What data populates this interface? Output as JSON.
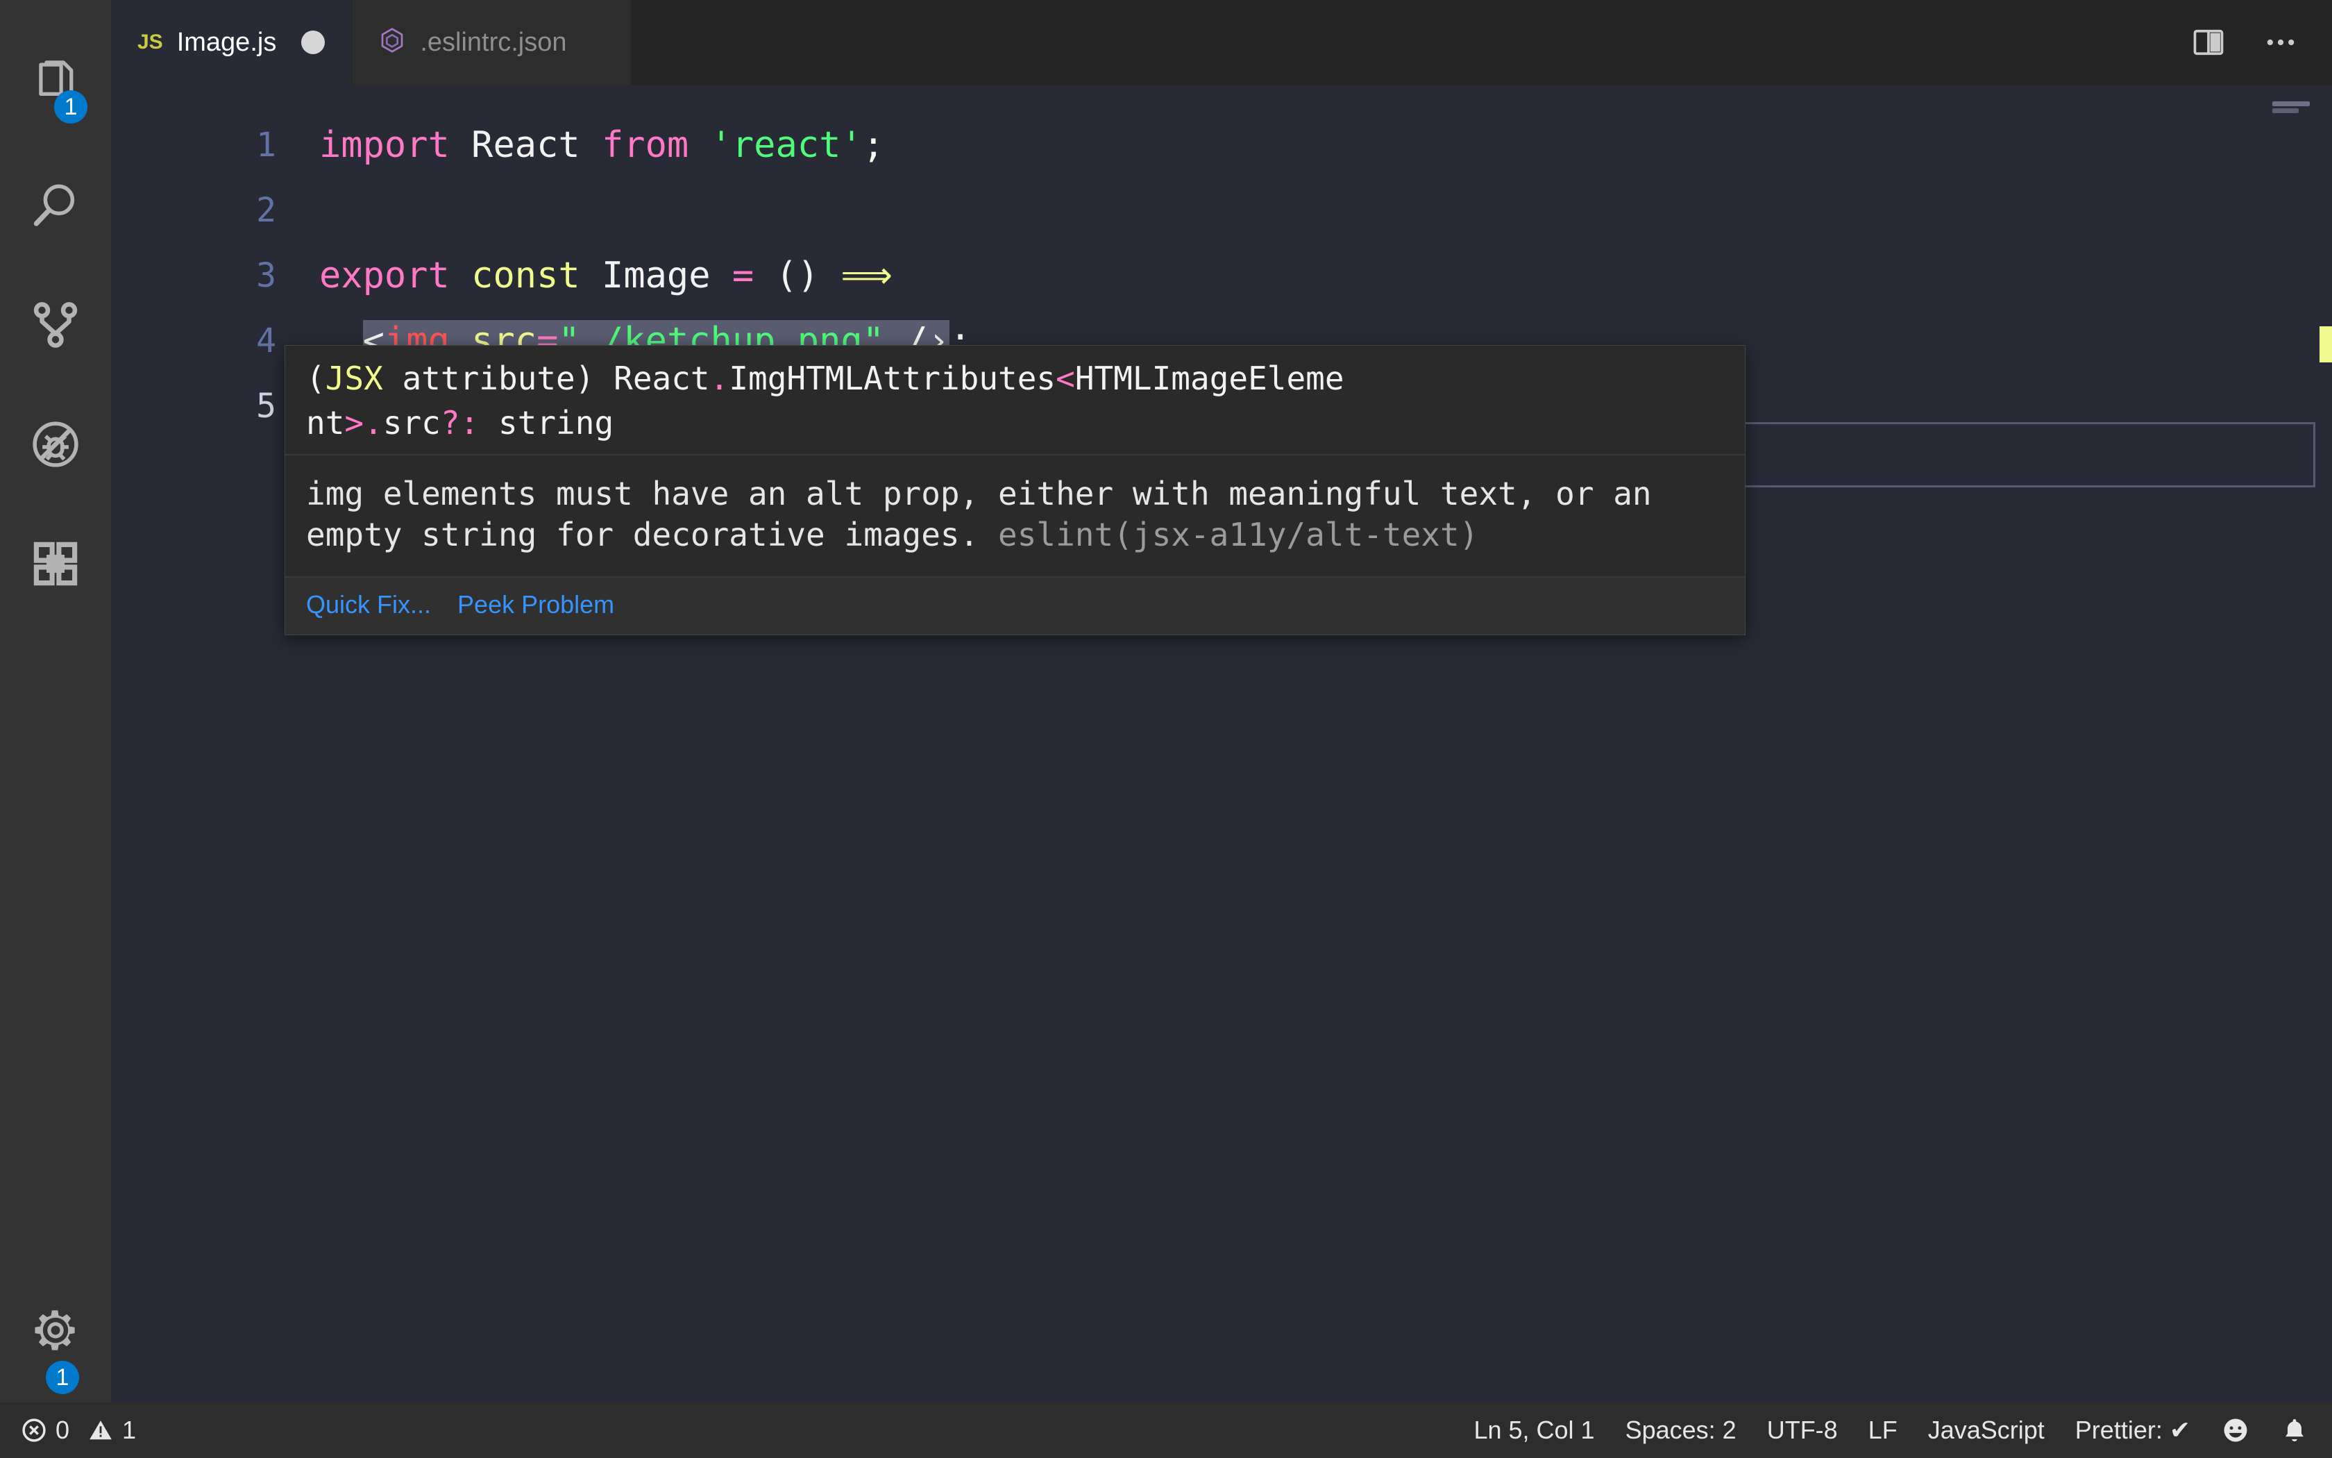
{
  "window": {
    "theme_bg": "#282a36",
    "accent": "#007acc"
  },
  "activitybar": {
    "items": [
      {
        "name": "explorer",
        "icon": "files-icon",
        "badge": "1"
      },
      {
        "name": "search",
        "icon": "search-icon",
        "badge": ""
      },
      {
        "name": "source-control",
        "icon": "source-control-icon",
        "badge": ""
      },
      {
        "name": "run-and-debug",
        "icon": "debug-alt-icon",
        "badge": ""
      },
      {
        "name": "extensions",
        "icon": "extensions-icon",
        "badge": ""
      }
    ],
    "bottom": [
      {
        "name": "manage",
        "icon": "gear-icon",
        "badge": "1"
      }
    ]
  },
  "tabs": {
    "items": [
      {
        "label": "Image.js",
        "icon": "js-icon",
        "icon_text": "JS",
        "active": true,
        "dirty": true
      },
      {
        "label": ".eslintrc.json",
        "icon": "eslint-icon",
        "icon_text": "",
        "active": false,
        "dirty": false
      }
    ],
    "actions": [
      {
        "name": "split-editor-right",
        "icon": "split-editor-icon"
      },
      {
        "name": "more-actions",
        "icon": "ellipsis-icon",
        "glyph": "⋯"
      }
    ]
  },
  "editor": {
    "language": "JavaScript",
    "lines": [
      {
        "num": "1",
        "tokens": [
          {
            "t": "import",
            "c": "t-key"
          },
          {
            "t": " ",
            "c": "t-plain"
          },
          {
            "t": "React",
            "c": "t-plain"
          },
          {
            "t": " ",
            "c": "t-plain"
          },
          {
            "t": "from",
            "c": "t-key"
          },
          {
            "t": " ",
            "c": "t-plain"
          },
          {
            "t": "'react'",
            "c": "t-str"
          },
          {
            "t": ";",
            "c": "t-punct"
          }
        ]
      },
      {
        "num": "2",
        "tokens": []
      },
      {
        "num": "3",
        "tokens": [
          {
            "t": "export",
            "c": "t-key"
          },
          {
            "t": " ",
            "c": "t-plain"
          },
          {
            "t": "const",
            "c": "t-yellow"
          },
          {
            "t": " ",
            "c": "t-plain"
          },
          {
            "t": "Image",
            "c": "t-plain"
          },
          {
            "t": " ",
            "c": "t-plain"
          },
          {
            "t": "=",
            "c": "t-key"
          },
          {
            "t": " ",
            "c": "t-plain"
          },
          {
            "t": "()",
            "c": "t-plain"
          },
          {
            "t": " ",
            "c": "t-plain"
          },
          {
            "t": "⟹",
            "c": "t-yellow"
          }
        ]
      },
      {
        "num": "4",
        "raw": "  <img src=\"./ketchup.png\" />;"
      },
      {
        "num": "5",
        "raw": ""
      }
    ],
    "line4": {
      "indent": "  ",
      "selected_text": "<img src=\"./ketchup.png\" />",
      "trailing": ";",
      "parts": [
        {
          "t": "<",
          "c": "t-punct"
        },
        {
          "t": "img",
          "c": "t-tag"
        },
        {
          "t": " ",
          "c": "t-plain"
        },
        {
          "t": "src",
          "c": "t-yellow"
        },
        {
          "t": "=",
          "c": "t-key"
        },
        {
          "t": "\"./ketchup.png\"",
          "c": "t-str"
        },
        {
          "t": " ",
          "c": "t-plain"
        },
        {
          "t": "∕›",
          "c": "t-punct"
        }
      ]
    },
    "current_line": "5"
  },
  "hover": {
    "signature": "(JSX attribute) React.ImgHTMLAttributes<HTMLImageEleme\nnt>.src?: string",
    "signature_parts": [
      {
        "t": "(",
        "c": "t-punct"
      },
      {
        "t": "JSX",
        "c": "t-yellow"
      },
      {
        "t": " attribute) React",
        "c": "t-plain"
      },
      {
        "t": ".",
        "c": "t-key"
      },
      {
        "t": "ImgHTMLAttributes",
        "c": "t-plain"
      },
      {
        "t": "<",
        "c": "t-key"
      },
      {
        "t": "HTMLImageEleme",
        "c": "t-plain"
      },
      {
        "t": "\n",
        "c": "t-plain"
      },
      {
        "t": "nt",
        "c": "t-plain"
      },
      {
        "t": ">",
        "c": "t-key"
      },
      {
        "t": ".",
        "c": "t-key"
      },
      {
        "t": "src",
        "c": "t-plain"
      },
      {
        "t": "?:",
        "c": "t-key"
      },
      {
        "t": " string",
        "c": "t-plain"
      }
    ],
    "message": "img elements must have an alt prop, either with meaningful text, or an empty string for decorative images.",
    "rule_source": "eslint(jsx-a11y/alt-text)",
    "actions": [
      {
        "label": "Quick Fix...",
        "name": "quick-fix-link"
      },
      {
        "label": "Peek Problem",
        "name": "peek-problem-link"
      }
    ]
  },
  "statusbar": {
    "left": [
      {
        "name": "error-count",
        "icon": "error-circle-icon",
        "value": "0"
      },
      {
        "name": "warning-count",
        "icon": "warning-triangle-icon",
        "value": "1"
      }
    ],
    "right": [
      {
        "name": "cursor-position",
        "label": "Ln 5, Col 1"
      },
      {
        "name": "indentation",
        "label": "Spaces: 2"
      },
      {
        "name": "encoding",
        "label": "UTF-8"
      },
      {
        "name": "eol",
        "label": "LF"
      },
      {
        "name": "language-mode",
        "label": "JavaScript"
      },
      {
        "name": "prettier-status",
        "label": "Prettier: ✔"
      },
      {
        "name": "feedback",
        "label": "",
        "icon": "smiley-icon"
      },
      {
        "name": "notifications",
        "label": "",
        "icon": "bell-icon"
      }
    ]
  }
}
